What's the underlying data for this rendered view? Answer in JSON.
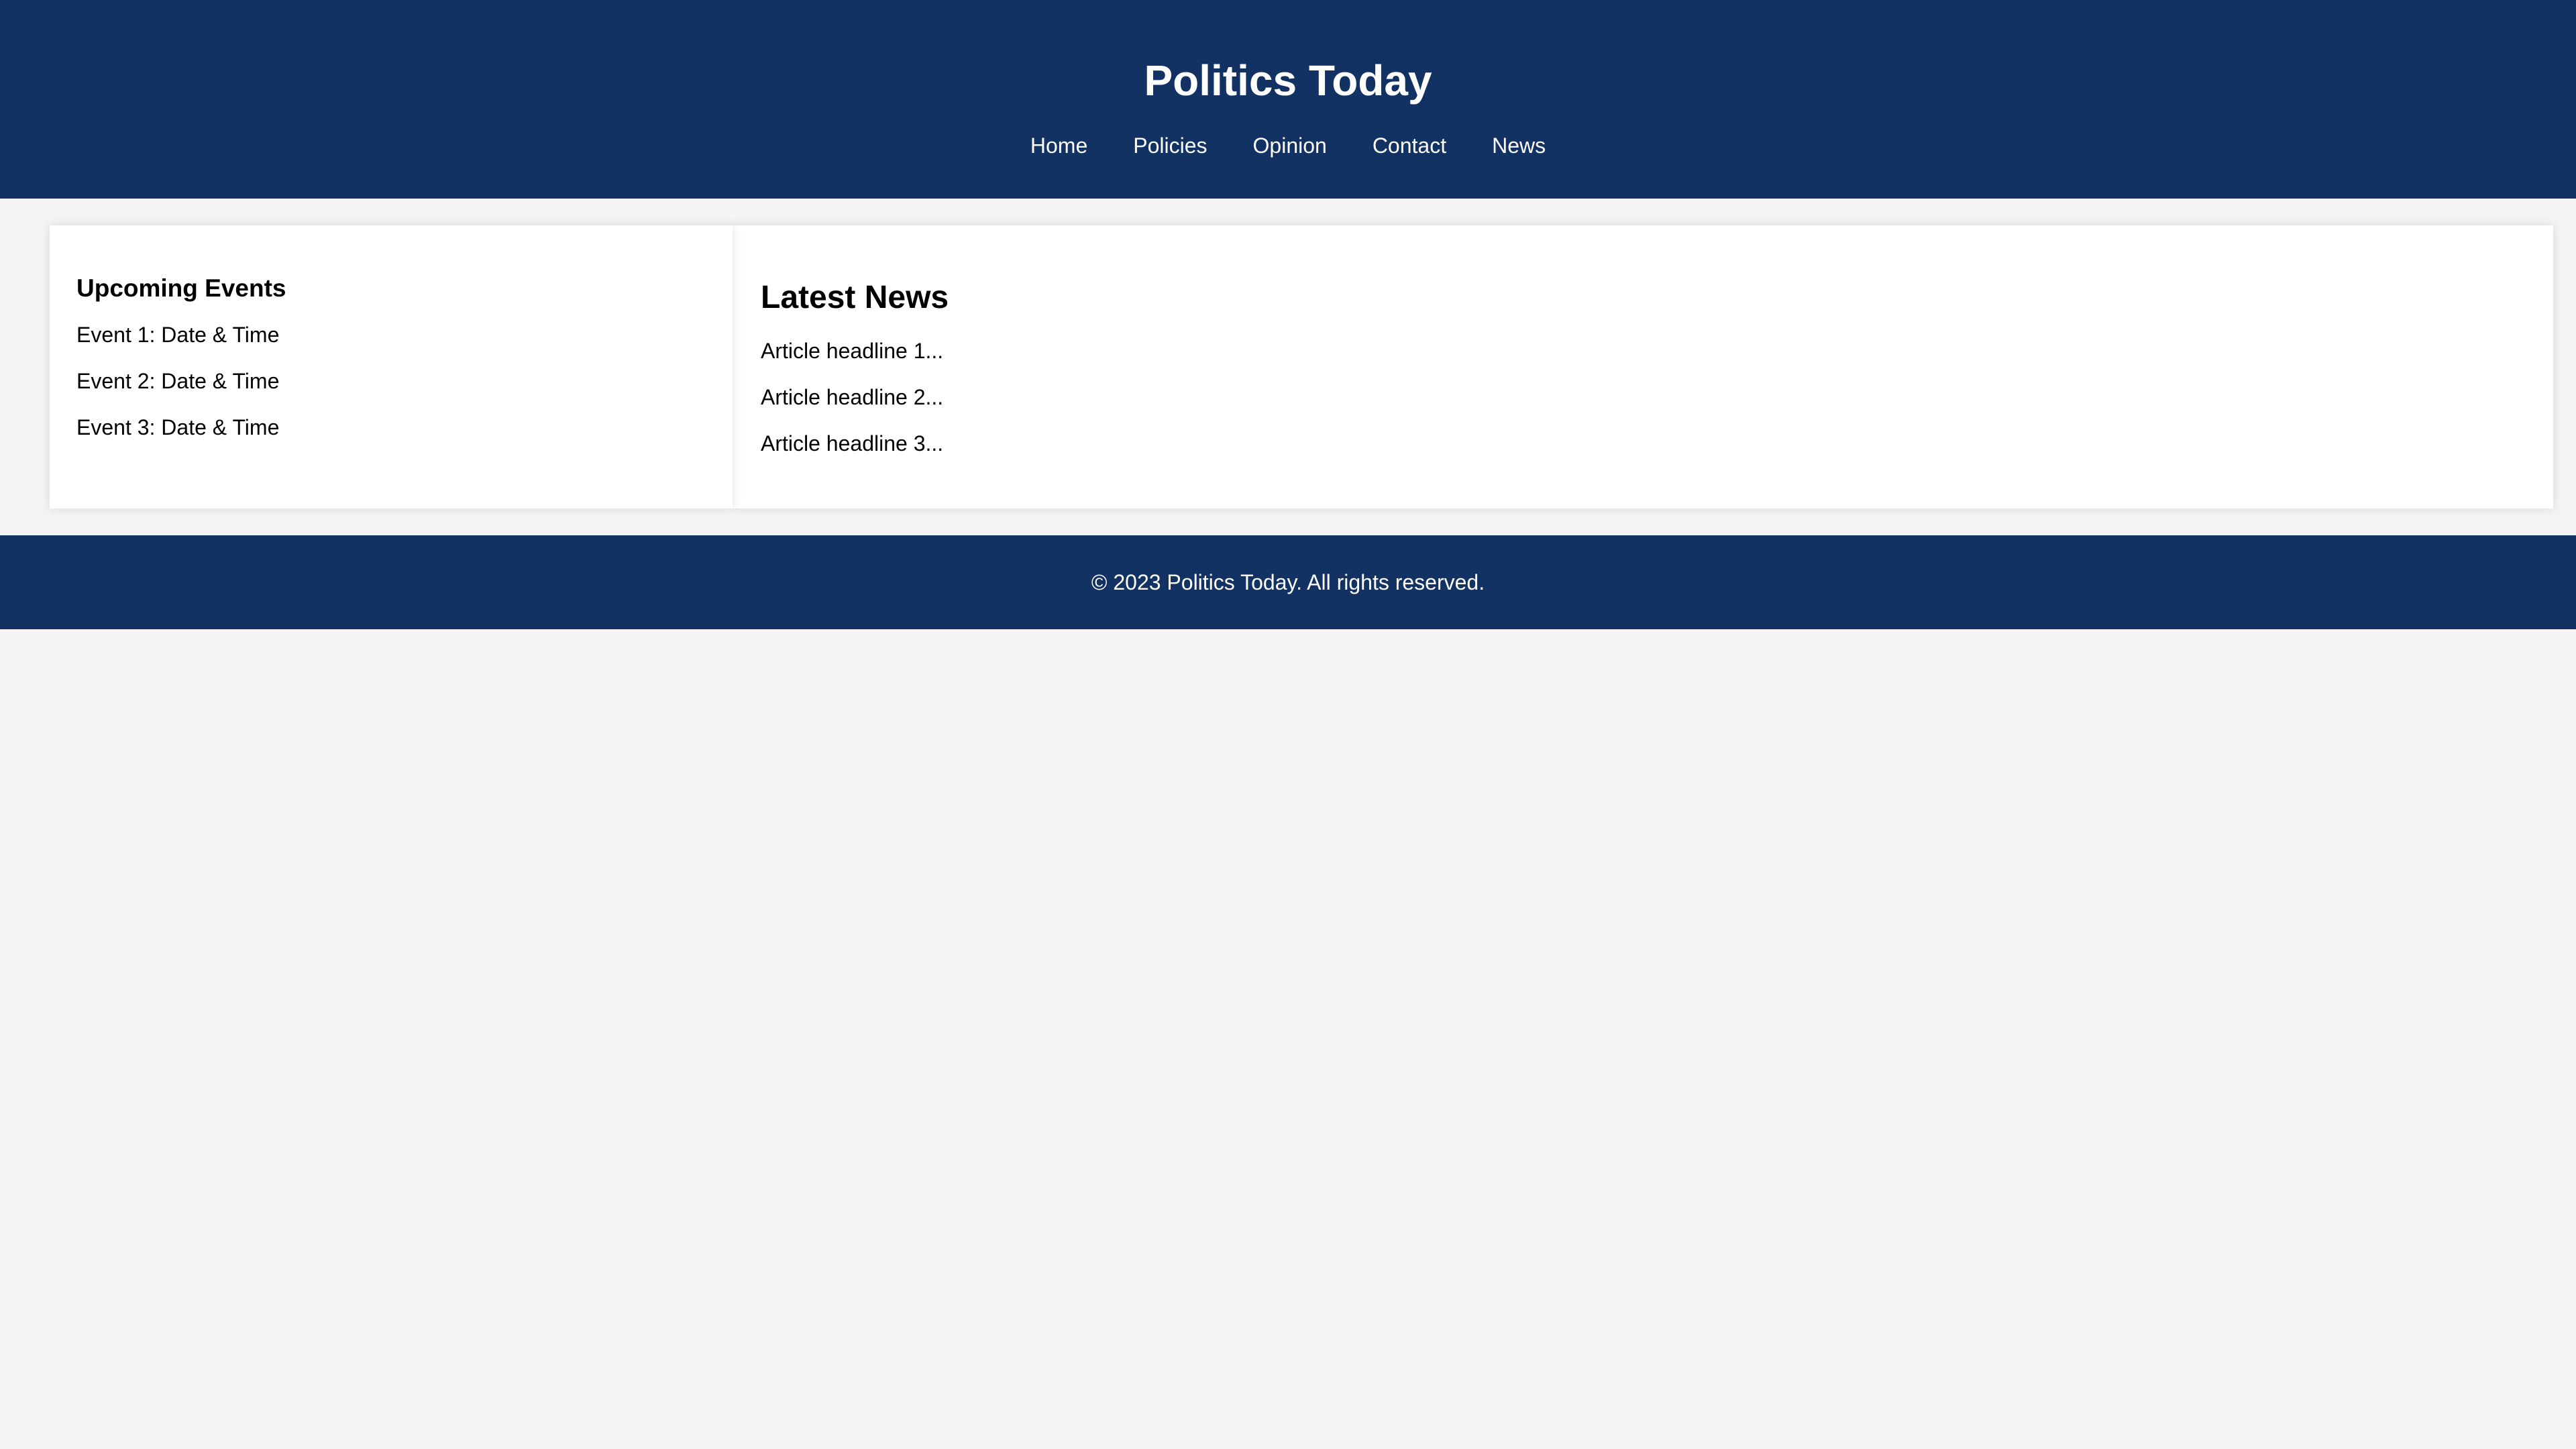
{
  "header": {
    "title": "Politics Today",
    "nav": [
      {
        "label": "Home"
      },
      {
        "label": "Policies"
      },
      {
        "label": "Opinion"
      },
      {
        "label": "Contact"
      },
      {
        "label": "News"
      }
    ]
  },
  "sidebar": {
    "title": "Upcoming Events",
    "events": [
      "Event 1: Date & Time",
      "Event 2: Date & Time",
      "Event 3: Date & Time"
    ]
  },
  "main": {
    "title": "Latest News",
    "articles": [
      "Article headline 1...",
      "Article headline 2...",
      "Article headline 3..."
    ]
  },
  "footer": {
    "text": "© 2023 Politics Today. All rights reserved."
  },
  "colors": {
    "header_bg": "#133264",
    "page_bg": "#f4f4f4",
    "panel_bg": "#ffffff"
  }
}
